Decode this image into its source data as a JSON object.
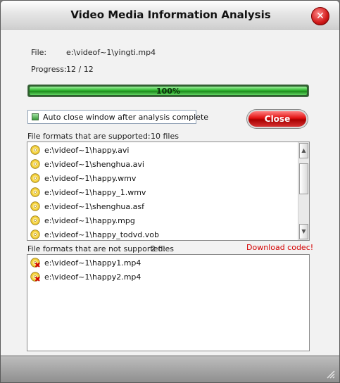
{
  "window": {
    "title": "Video Media Information Analysis"
  },
  "info": {
    "file_label": "File:",
    "file_value": "e:\\videof~1\\yingti.mp4",
    "progress_label": "Progress:",
    "progress_value": "12 / 12",
    "progress_percent_text": "100%",
    "progress_fraction": 1.0
  },
  "options": {
    "auto_close_label": "Auto close window after analysis complete",
    "auto_close_checked": true
  },
  "buttons": {
    "close_label": "Close"
  },
  "supported": {
    "header": "File formats that are supported:",
    "count": "10 files",
    "items": [
      "e:\\videof~1\\happy.avi",
      "e:\\videof~1\\shenghua.avi",
      "e:\\videof~1\\happy.wmv",
      "e:\\videof~1\\happy_1.wmv",
      "e:\\videof~1\\shenghua.asf",
      "e:\\videof~1\\happy.mpg",
      "e:\\videof~1\\happy_todvd.vob"
    ]
  },
  "unsupported": {
    "header": "File formats that are not supported:",
    "count": "2 files",
    "download_link": "Download codec!",
    "items": [
      "e:\\videof~1\\happy1.mp4",
      "e:\\videof~1\\happy2.mp4"
    ]
  },
  "colors": {
    "accent_green": "#2fb52f",
    "close_red": "#e01010",
    "link_red": "#d40000"
  },
  "icons": {
    "supported_file": "cd-disc-icon",
    "unsupported_file": "cd-disc-error-icon",
    "title_close": "close-icon"
  }
}
